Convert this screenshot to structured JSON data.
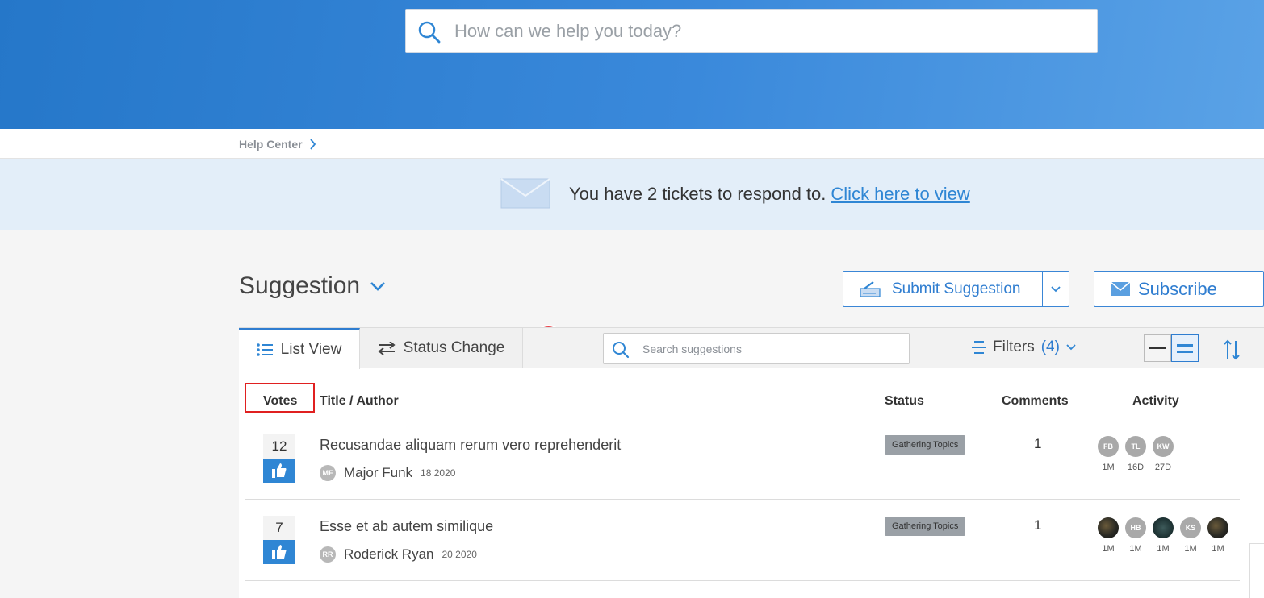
{
  "search": {
    "placeholder": "How can we help you today?"
  },
  "breadcrumb": {
    "label": "Help Center"
  },
  "notice": {
    "count": "2",
    "message": "You have 2 tickets to respond to.",
    "link": "Click here to view"
  },
  "page": {
    "title": "Suggestion"
  },
  "actions": {
    "submit_label": "Submit Suggestion",
    "subscribe_label": "Subscribe"
  },
  "toolbar": {
    "tabs": [
      {
        "label": "List View",
        "icon": "list-icon"
      },
      {
        "label": "Status Change",
        "icon": "swap-icon"
      }
    ],
    "search_placeholder": "Search suggestions",
    "filters_label": "Filters",
    "filters_count": "(4)"
  },
  "columns": {
    "votes": "Votes",
    "title": "Title / Author",
    "status": "Status",
    "comments": "Comments",
    "activity": "Activity"
  },
  "rows": [
    {
      "votes": "12",
      "title": "Recusandae aliquam rerum vero reprehenderit",
      "author_initials": "MF",
      "author": "Major Funk",
      "date": "18 2020",
      "status": "Gathering Topics",
      "comments": "1",
      "activity": [
        {
          "initials": "FB",
          "time": "1M"
        },
        {
          "initials": "TL",
          "time": "16D"
        },
        {
          "initials": "KW",
          "time": "27D"
        }
      ]
    },
    {
      "votes": "7",
      "title": "Esse et ab autem similique",
      "author_initials": "RR",
      "author": "Roderick Ryan",
      "date": "20 2020",
      "status": "Gathering Topics",
      "comments": "1",
      "activity": [
        {
          "initials": "",
          "time": "1M"
        },
        {
          "initials": "HB",
          "time": "1M"
        },
        {
          "initials": "",
          "time": "1M"
        },
        {
          "initials": "KS",
          "time": "1M"
        },
        {
          "initials": "",
          "time": "1M"
        }
      ]
    }
  ],
  "colors": {
    "hero": "#2f80d3",
    "accent": "#2f86d4",
    "badge": "#e8424a",
    "highlight_box": "#e02020",
    "status_tag": "#9aa0a6"
  }
}
